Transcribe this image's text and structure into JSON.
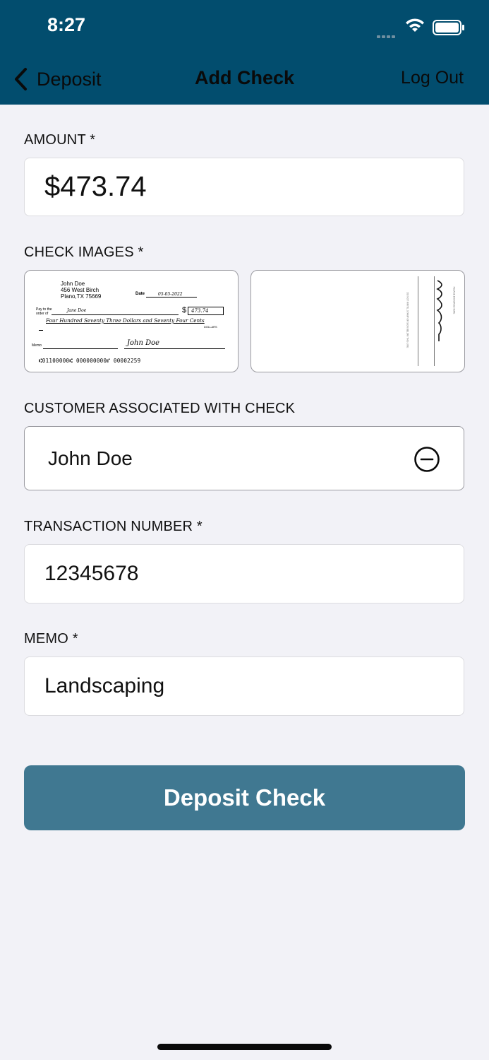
{
  "status_bar": {
    "time": "8:27"
  },
  "nav": {
    "back_label": "Deposit",
    "title": "Add Check",
    "logout_label": "Log Out"
  },
  "amount": {
    "label": "AMOUNT *",
    "value": "$473.74"
  },
  "check_images": {
    "label": "CHECK IMAGES *",
    "front": {
      "name": "John Doe",
      "address1": "456 West Birch",
      "address2": "Plano,TX 75669",
      "date_label": "Date",
      "date_value": "05-05-2022",
      "pay_label_1": "Pay to the",
      "pay_label_2": "order of",
      "payee": "Jane Doe",
      "amount_box": "473.74",
      "written_amount": "Four Hundred Seventy Three Dollars and Seventy Four Cents",
      "dollars_label": "DOLLARS",
      "memo_label": "Memo",
      "signature": "John Doe",
      "micr": "⑆01100000⑆ 000000000⑈ 00002259"
    },
    "back": {
      "endorse_text": "PLEASE ENDORSE HERE",
      "warning_text": "DO NOT WRITE, STAMP OR SIGN BELOW THIS LINE"
    }
  },
  "customer": {
    "label": "CUSTOMER ASSOCIATED WITH CHECK",
    "value": "John Doe"
  },
  "transaction": {
    "label": "TRANSACTION NUMBER *",
    "value": "12345678"
  },
  "memo": {
    "label": "MEMO *",
    "value": "Landscaping"
  },
  "deposit_button": {
    "label": "Deposit Check"
  },
  "colors": {
    "header": "#024d6e",
    "button": "#407891",
    "background": "#f2f2f7"
  },
  "icons": {
    "back": "chevron-left-icon",
    "remove": "minus-circle-icon",
    "wifi": "wifi-icon",
    "battery": "battery-icon"
  }
}
